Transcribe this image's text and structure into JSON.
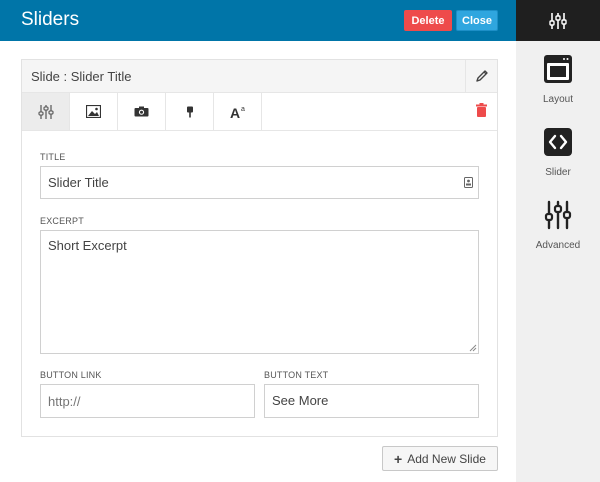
{
  "header": {
    "title": "Sliders",
    "delete_label": "Delete",
    "close_label": "Close"
  },
  "sidebar": {
    "items": [
      {
        "label": "Layout",
        "icon": "layout-icon"
      },
      {
        "label": "Slider",
        "icon": "code-icon"
      },
      {
        "label": "Advanced",
        "icon": "sliders-icon"
      }
    ]
  },
  "panel": {
    "title": "Slide : Slider Title",
    "tabs": [
      {
        "icon": "sliders-icon",
        "active": true
      },
      {
        "icon": "image-icon",
        "active": false
      },
      {
        "icon": "camera-icon",
        "active": false
      },
      {
        "icon": "brush-icon",
        "active": false
      },
      {
        "icon": "typography-icon",
        "active": false
      }
    ]
  },
  "form": {
    "title_label": "TITLE",
    "title_value": "Slider Title",
    "excerpt_label": "EXCERPT",
    "excerpt_value": "Short Excerpt",
    "button_link_label": "BUTTON LINK",
    "button_link_placeholder": "http://",
    "button_text_label": "BUTTON TEXT",
    "button_text_value": "See More"
  },
  "footer": {
    "add_label": "Add New Slide"
  },
  "colors": {
    "header": "#0075a8",
    "delete": "#ee4b4b",
    "close": "#2fa6df",
    "sidebar_top": "#1f1f1f",
    "trash": "#ee4b4b"
  }
}
